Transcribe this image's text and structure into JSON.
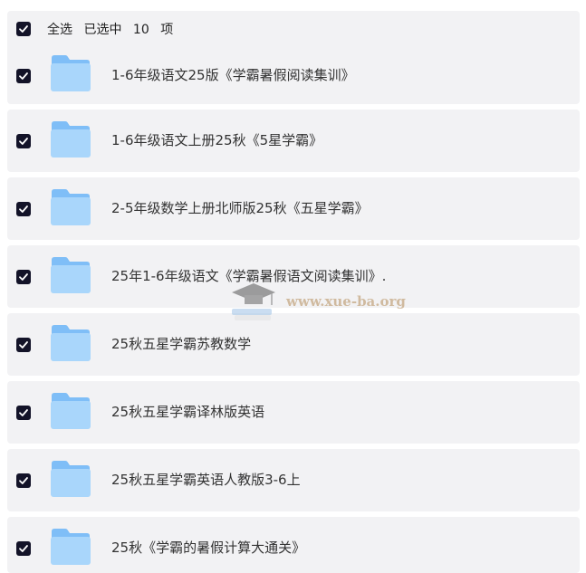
{
  "header": {
    "select_all_label": "全选",
    "selected_prefix": "已选中",
    "selected_count": "10",
    "selected_suffix": "项"
  },
  "folders": [
    {
      "label": "1-6年级语文25版《学霸暑假阅读集训》"
    },
    {
      "label": "1-6年级语文上册25秋《5星学霸》"
    },
    {
      "label": "2-5年级数学上册北师版25秋《五星学霸》"
    },
    {
      "label": "25年1-6年级语文《学霸暑假语文阅读集训》."
    },
    {
      "label": "25秋五星学霸苏教数学"
    },
    {
      "label": "25秋五星学霸译林版英语"
    },
    {
      "label": "25秋五星学霸英语人教版3-6上"
    },
    {
      "label": "25秋《学霸的暑假计算大通关》"
    }
  ],
  "watermark": {
    "text": "www.xue-ba.org"
  },
  "colors": {
    "checkbox": "#131328",
    "row_bg": "#f2f2f4",
    "folder_light": "#a9d6fb",
    "folder_dark": "#7fbef7"
  }
}
